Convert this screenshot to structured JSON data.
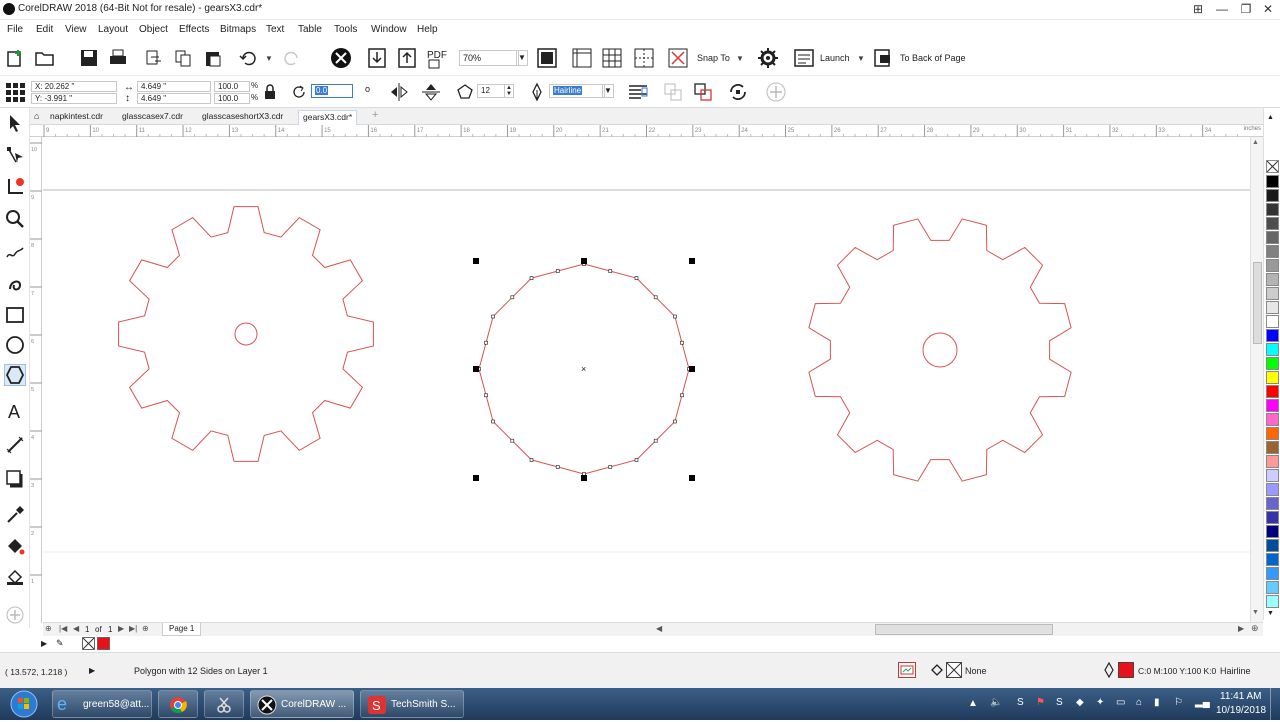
{
  "window": {
    "title": "CorelDRAW 2018 (64-Bit Not for resale) - gearsX3.cdr*",
    "minimize": "—",
    "maximize": "❐",
    "close": "✕"
  },
  "menu": [
    "File",
    "Edit",
    "View",
    "Layout",
    "Object",
    "Effects",
    "Bitmaps",
    "Text",
    "Table",
    "Tools",
    "Window",
    "Help"
  ],
  "toolbar": {
    "zoom_value": "70%",
    "snap_to_label": "Snap To",
    "launch_label": "Launch",
    "to_back_label": "To Back of Page",
    "pdf_label": "PDF"
  },
  "property_bar": {
    "x_value": "X: 20.262 \"",
    "y_value": "Y: -3.991 \"",
    "width_value": "4.649 \"",
    "height_value": "4.649 \"",
    "scale_w": "100.0",
    "scale_h": "100.0",
    "percent_w": "%",
    "percent_h": "%",
    "angle_value": "0.0",
    "degree_symbol": "o",
    "sides_value": "12",
    "outline_width": "Hairline"
  },
  "tabs": [
    {
      "label": "napkintest.cdr",
      "active": false
    },
    {
      "label": "glasscasex7.cdr",
      "active": false
    },
    {
      "label": "glasscaseshortX3.cdr",
      "active": false
    },
    {
      "label": "gearsX3.cdr*",
      "active": true
    }
  ],
  "ruler": {
    "units_label": "inches",
    "h_ticks": [
      "9",
      "10",
      "11",
      "12",
      "13",
      "14",
      "15",
      "16",
      "17",
      "18",
      "19",
      "20",
      "21",
      "22",
      "23",
      "24",
      "25",
      "26",
      "27",
      "28",
      "29",
      "30",
      "31",
      "32",
      "33",
      "34"
    ],
    "v_ticks": [
      "10",
      "9",
      "8",
      "7",
      "6",
      "5",
      "4",
      "3",
      "2",
      "1"
    ]
  },
  "page_nav": {
    "current": "1",
    "of_label": "of",
    "total": "1",
    "page_tab": "Page 1"
  },
  "status": {
    "cursor_coords": "( 13.572, 1.218 )",
    "selection_info": "Polygon with 12 Sides on Layer 1",
    "fill_label": "None",
    "outline_color": "C:0 M:100 Y:100 K:0",
    "outline_width": "Hairline"
  },
  "taskbar": {
    "items": [
      {
        "label": "green58@att..."
      },
      {
        "label": ""
      },
      {
        "label": ""
      },
      {
        "label": "CorelDRAW ..."
      },
      {
        "label": "TechSmith S..."
      }
    ],
    "time": "11:41 AM",
    "date": "10/19/2018"
  },
  "colors": {
    "outline_red": "#e8323c",
    "gear_stroke": "#d9534f",
    "selection_black": "#000000",
    "taskbar_blue": "#2b4a70"
  },
  "palette": [
    "#000000",
    "#1a1a1a",
    "#333333",
    "#4d4d4d",
    "#666666",
    "#808080",
    "#999999",
    "#b3b3b3",
    "#cccccc",
    "#e6e6e6",
    "#ffffff",
    "#0000ff",
    "#00ffff",
    "#00ff00",
    "#ffff00",
    "#ff0000",
    "#ff00ff",
    "#ff66cc",
    "#ff6600",
    "#996633",
    "#ff9999",
    "#ccccff",
    "#9999ff",
    "#6666cc",
    "#3333aa",
    "#00007f",
    "#004d99",
    "#0066cc",
    "#3399ff",
    "#66ccff",
    "#99ffff"
  ]
}
